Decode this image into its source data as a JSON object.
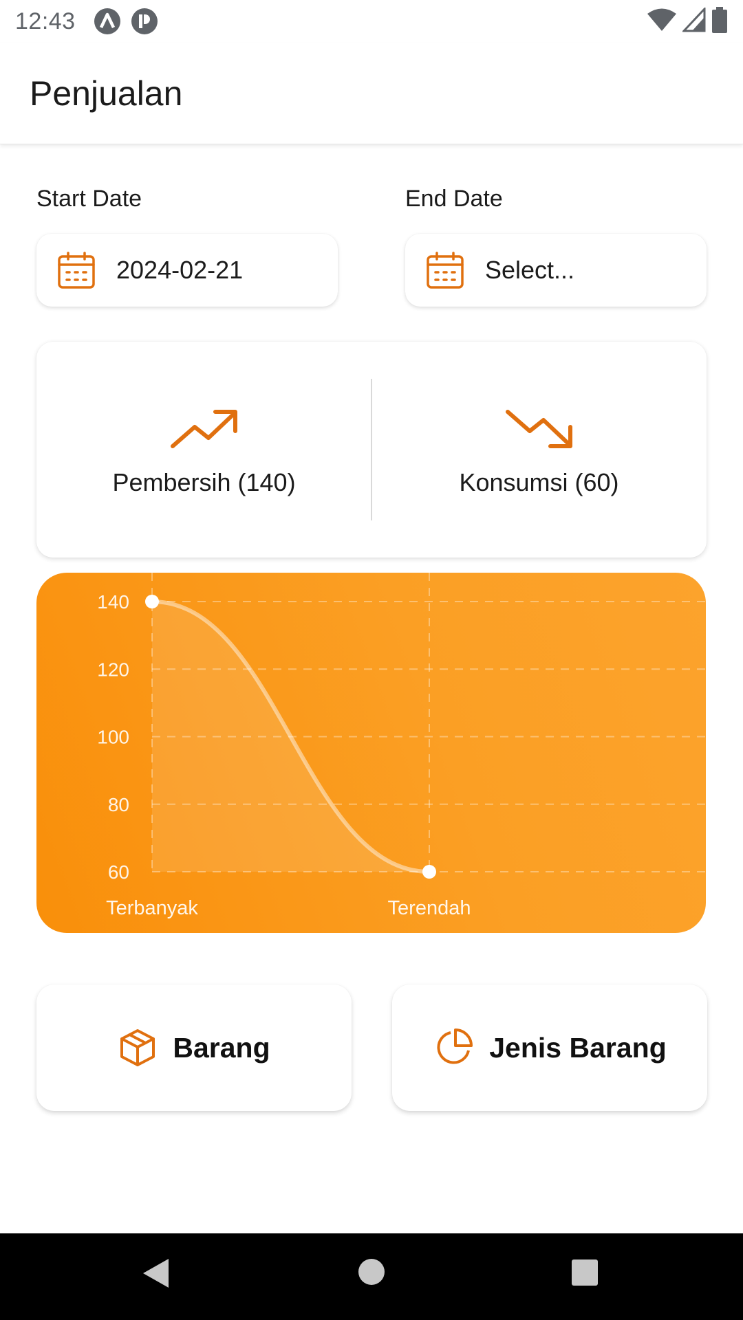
{
  "status_bar": {
    "time": "12:43",
    "left_icons": [
      "a-circle-icon",
      "r-circle-icon"
    ],
    "right_icons": [
      "wifi-icon",
      "signal-icon",
      "battery-icon"
    ]
  },
  "app_bar": {
    "title": "Penjualan"
  },
  "date_filter": {
    "start": {
      "label": "Start Date",
      "value": "2024-02-21",
      "icon": "calendar-icon"
    },
    "end": {
      "label": "End Date",
      "value": "Select...",
      "icon": "calendar-icon"
    }
  },
  "summary": {
    "highest": {
      "label": "Pembersih (140)",
      "icon": "trending-up-icon"
    },
    "lowest": {
      "label": "Konsumsi (60)",
      "icon": "trending-down-icon"
    }
  },
  "chart_data": {
    "type": "line",
    "categories": [
      "Terbanyak",
      "Terendah"
    ],
    "series": [
      {
        "values": [
          140,
          60
        ]
      }
    ],
    "y_ticks": [
      60,
      80,
      100,
      120,
      140
    ],
    "ylim": [
      60,
      140
    ],
    "grid": true,
    "colors": {
      "background": "#fb9a1c",
      "line": "#ffffff"
    }
  },
  "actions": [
    {
      "label": "Barang",
      "icon": "box-icon"
    },
    {
      "label": "Jenis Barang",
      "icon": "pie-chart-icon"
    }
  ],
  "colors": {
    "accent": "#e0700f",
    "chart_bg": "#fb9a1c"
  },
  "nav_bar": {
    "icons": [
      "back-icon",
      "home-icon",
      "recents-icon"
    ]
  }
}
